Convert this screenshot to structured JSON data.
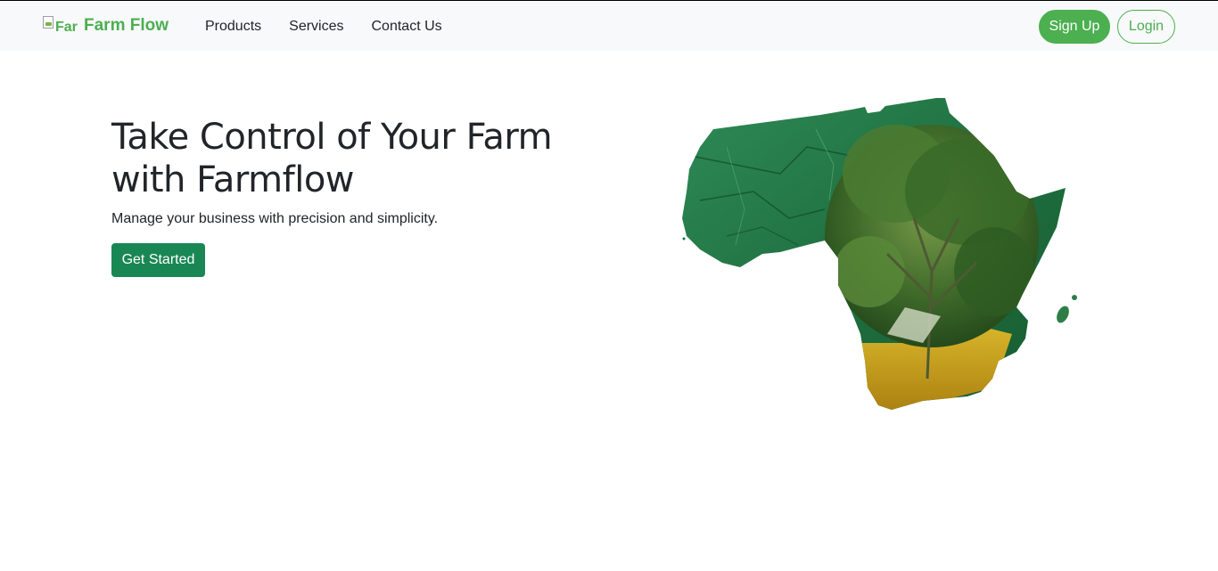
{
  "navbar": {
    "logo_alt": "Farm Flow Logo",
    "brand": "Farm Flow",
    "links": [
      "Products",
      "Services",
      "Contact Us"
    ],
    "signup_label": "Sign Up",
    "login_label": "Login"
  },
  "hero": {
    "title": "Take Control of Your Farm with Farmflow",
    "subtitle": "Manage your business with precision and simplicity.",
    "cta_label": "Get Started",
    "image_icon": "africa-map-forest-image"
  },
  "colors": {
    "brand_green": "#4caf50",
    "cta_green": "#198754",
    "navbar_bg": "#f8f9fa"
  }
}
